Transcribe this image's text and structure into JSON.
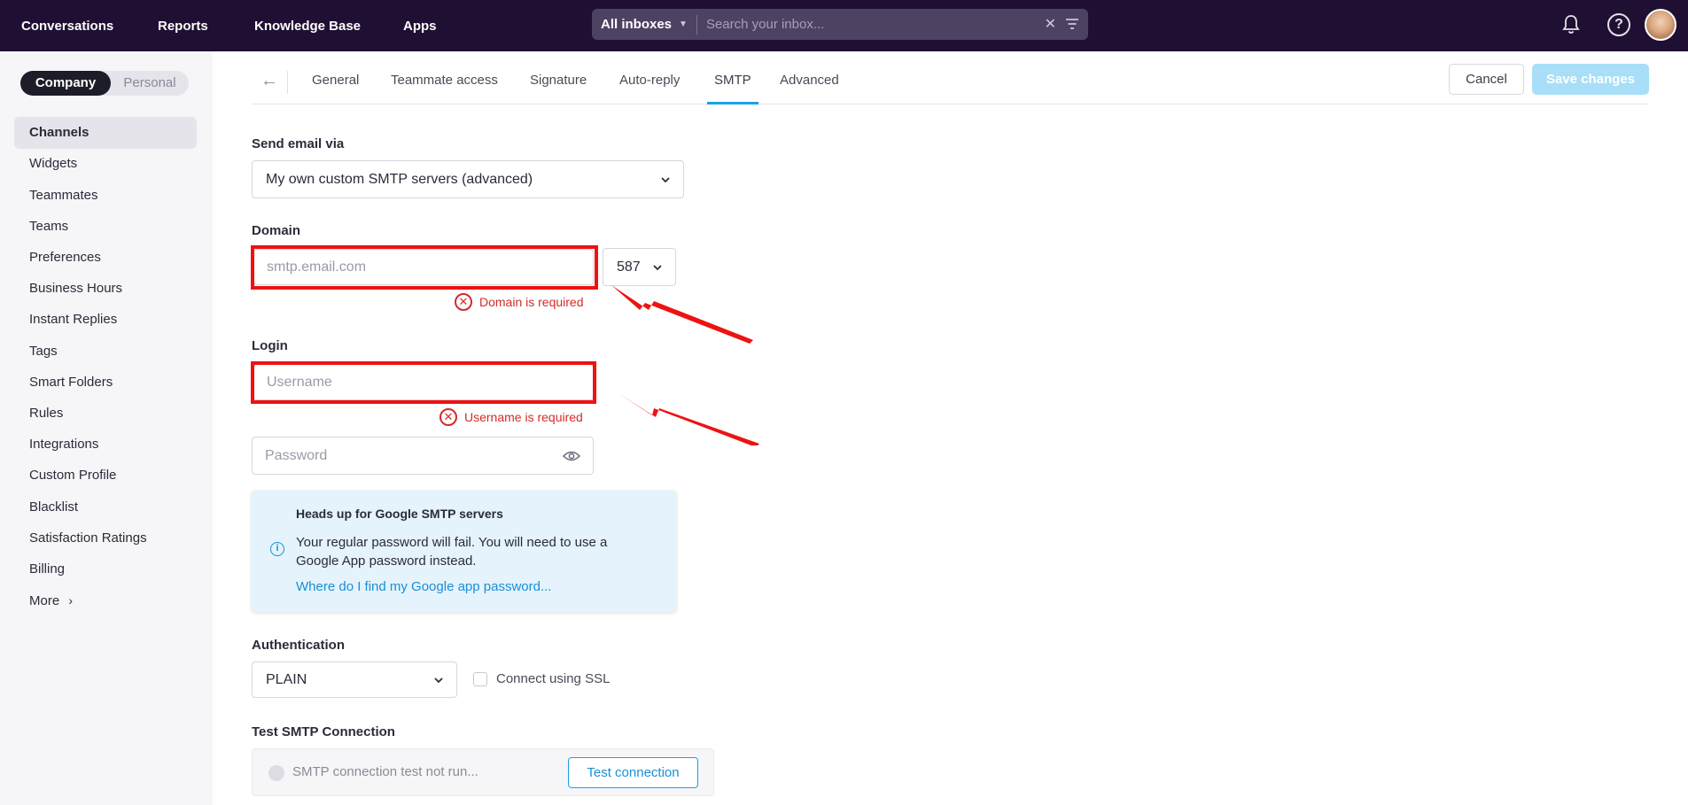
{
  "topnav": {
    "items": [
      "Conversations",
      "Reports",
      "Knowledge Base",
      "Apps"
    ],
    "inbox_select": "All inboxes",
    "search_placeholder": "Search your inbox..."
  },
  "sidebar": {
    "toggle": {
      "company": "Company",
      "personal": "Personal"
    },
    "items": [
      {
        "label": "Channels",
        "active": true
      },
      {
        "label": "Widgets"
      },
      {
        "label": "Teammates"
      },
      {
        "label": "Teams"
      },
      {
        "label": "Preferences"
      },
      {
        "label": "Business Hours"
      },
      {
        "label": "Instant Replies"
      },
      {
        "label": "Tags"
      },
      {
        "label": "Smart Folders"
      },
      {
        "label": "Rules"
      },
      {
        "label": "Integrations"
      },
      {
        "label": "Custom Profile"
      },
      {
        "label": "Blacklist"
      },
      {
        "label": "Satisfaction Ratings"
      },
      {
        "label": "Billing"
      },
      {
        "label": "More"
      }
    ]
  },
  "tabs": {
    "items": [
      "General",
      "Teammate access",
      "Signature",
      "Auto-reply",
      "SMTP",
      "Advanced"
    ],
    "active": "SMTP",
    "cancel": "Cancel",
    "save": "Save changes"
  },
  "form": {
    "send_via_label": "Send email via",
    "send_via_value": "My own custom SMTP servers (advanced)",
    "domain_label": "Domain",
    "domain_placeholder": "smtp.email.com",
    "port_value": "587",
    "domain_error": "Domain is required",
    "login_label": "Login",
    "username_placeholder": "Username",
    "username_error": "Username is required",
    "password_placeholder": "Password",
    "info_title": "Heads up for Google SMTP servers",
    "info_body": "Your regular password will fail. You will need to use a Google App password instead.",
    "info_link": "Where do I find my Google app password...",
    "auth_label": "Authentication",
    "auth_value": "PLAIN",
    "ssl_label": "Connect using SSL",
    "test_label": "Test SMTP Connection",
    "test_status": "SMTP connection test not run...",
    "test_button": "Test connection"
  },
  "colors": {
    "topbar": "#1f1033",
    "accent": "#1aa1e6",
    "error": "#d52a2a",
    "annotation": "#ee1212"
  }
}
